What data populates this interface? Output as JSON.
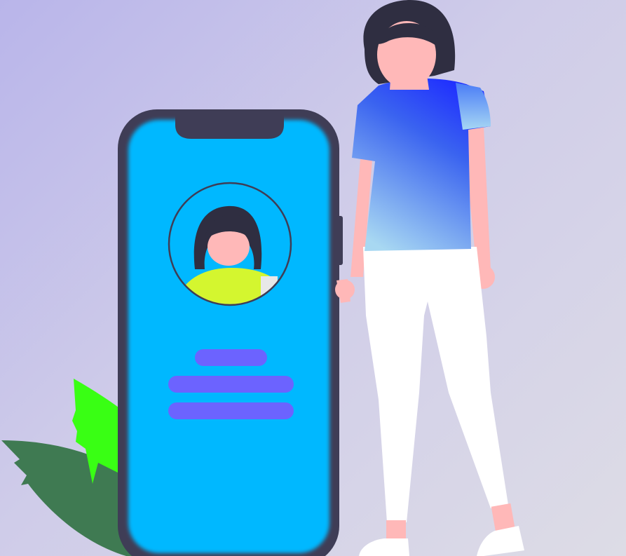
{
  "scene": {
    "description_label": "",
    "colors": {
      "background_start": "#b9b5ea",
      "background_end": "#dddce6",
      "phone_frame": "#3f3d56",
      "phone_screen": "#00b8ff",
      "avatar_ring": "#3f3d56",
      "avatar_hair": "#2f2e41",
      "avatar_skin": "#ffb8b8",
      "avatar_shirt": "#d4f62f",
      "profile_bars": "#6c63ff",
      "woman_hair": "#2f2e41",
      "woman_skin": "#ffb8b8",
      "woman_shirt_top": "#1e2cff",
      "woman_shirt_bottom": "#9fd0f2",
      "woman_pants": "#ffffff",
      "leaf_dark": "#3f7a52",
      "leaf_bright": "#39ff14"
    },
    "icons": {
      "phone": "smartphone-icon",
      "avatar": "user-avatar-icon",
      "leaves": "plant-leaf-icon",
      "person": "woman-figure-icon"
    },
    "profile_lines": 3
  }
}
